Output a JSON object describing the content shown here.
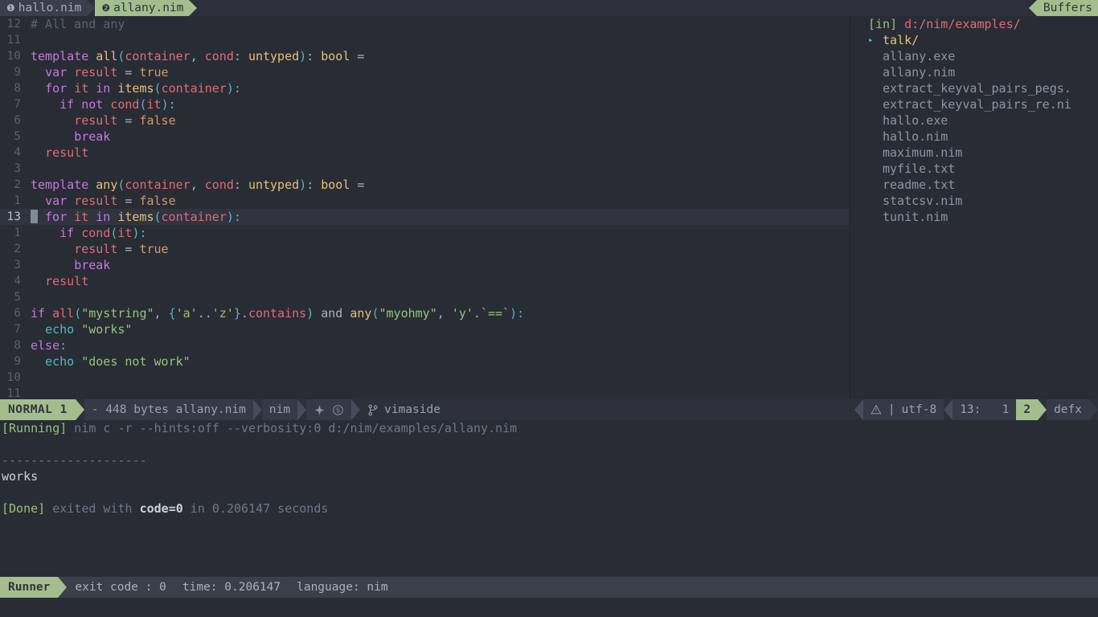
{
  "tabbar": {
    "tabs": [
      {
        "num": "❶",
        "label": "hallo.nim",
        "active": false
      },
      {
        "num": "❷",
        "label": "allany.nim",
        "active": true
      }
    ],
    "buffers_label": "Buffers"
  },
  "editor": {
    "lines": [
      {
        "gutter": "12",
        "current": false,
        "tokens": [
          {
            "t": "# All and any",
            "c": "t-cmt"
          }
        ]
      },
      {
        "gutter": "11",
        "current": false,
        "tokens": []
      },
      {
        "gutter": "10",
        "current": false,
        "tokens": [
          {
            "t": "template ",
            "c": "t-kw"
          },
          {
            "t": "all",
            "c": "t-fn"
          },
          {
            "t": "(",
            "c": "t-par"
          },
          {
            "t": "container",
            "c": "t-var"
          },
          {
            "t": ", ",
            "c": "t-plain"
          },
          {
            "t": "cond",
            "c": "t-var"
          },
          {
            "t": ": ",
            "c": "t-plain"
          },
          {
            "t": "untyped",
            "c": "t-typ"
          },
          {
            "t": ")",
            "c": "t-par"
          },
          {
            "t": ": ",
            "c": "t-plain"
          },
          {
            "t": "bool",
            "c": "t-typ"
          },
          {
            "t": " = ",
            "c": "t-plain"
          }
        ]
      },
      {
        "gutter": "9",
        "current": false,
        "tokens": [
          {
            "t": "  ",
            "c": "t-plain"
          },
          {
            "t": "var ",
            "c": "t-kw"
          },
          {
            "t": "result",
            "c": "t-var"
          },
          {
            "t": " = ",
            "c": "t-plain"
          },
          {
            "t": "true",
            "c": "t-bool"
          }
        ]
      },
      {
        "gutter": "8",
        "current": false,
        "tokens": [
          {
            "t": "  ",
            "c": "t-plain"
          },
          {
            "t": "for ",
            "c": "t-kw"
          },
          {
            "t": "it ",
            "c": "t-var"
          },
          {
            "t": "in ",
            "c": "t-kw"
          },
          {
            "t": "items",
            "c": "t-fn"
          },
          {
            "t": "(",
            "c": "t-par"
          },
          {
            "t": "container",
            "c": "t-var"
          },
          {
            "t": ")",
            "c": "t-par"
          },
          {
            "t": ":",
            "c": "t-par"
          }
        ]
      },
      {
        "gutter": "7",
        "current": false,
        "tokens": [
          {
            "t": "    ",
            "c": "t-plain"
          },
          {
            "t": "if ",
            "c": "t-kw"
          },
          {
            "t": "not ",
            "c": "t-kw"
          },
          {
            "t": "cond",
            "c": "t-var"
          },
          {
            "t": "(",
            "c": "t-par"
          },
          {
            "t": "it",
            "c": "t-var"
          },
          {
            "t": ")",
            "c": "t-par"
          },
          {
            "t": ":",
            "c": "t-par"
          }
        ]
      },
      {
        "gutter": "6",
        "current": false,
        "tokens": [
          {
            "t": "      ",
            "c": "t-plain"
          },
          {
            "t": "result",
            "c": "t-var"
          },
          {
            "t": " = ",
            "c": "t-plain"
          },
          {
            "t": "false",
            "c": "t-bool"
          }
        ]
      },
      {
        "gutter": "5",
        "current": false,
        "tokens": [
          {
            "t": "      ",
            "c": "t-plain"
          },
          {
            "t": "break",
            "c": "t-kw"
          }
        ]
      },
      {
        "gutter": "4",
        "current": false,
        "tokens": [
          {
            "t": "  ",
            "c": "t-plain"
          },
          {
            "t": "result",
            "c": "t-var"
          }
        ]
      },
      {
        "gutter": "3",
        "current": false,
        "tokens": []
      },
      {
        "gutter": "2",
        "current": false,
        "tokens": [
          {
            "t": "template ",
            "c": "t-kw"
          },
          {
            "t": "any",
            "c": "t-fn"
          },
          {
            "t": "(",
            "c": "t-par"
          },
          {
            "t": "container",
            "c": "t-var"
          },
          {
            "t": ", ",
            "c": "t-plain"
          },
          {
            "t": "cond",
            "c": "t-var"
          },
          {
            "t": ": ",
            "c": "t-plain"
          },
          {
            "t": "untyped",
            "c": "t-typ"
          },
          {
            "t": ")",
            "c": "t-par"
          },
          {
            "t": ": ",
            "c": "t-plain"
          },
          {
            "t": "bool",
            "c": "t-typ"
          },
          {
            "t": " = ",
            "c": "t-plain"
          }
        ]
      },
      {
        "gutter": "1",
        "current": false,
        "tokens": [
          {
            "t": "  ",
            "c": "t-plain"
          },
          {
            "t": "var ",
            "c": "t-kw"
          },
          {
            "t": "result",
            "c": "t-var"
          },
          {
            "t": " = ",
            "c": "t-plain"
          },
          {
            "t": "false",
            "c": "t-bool"
          }
        ]
      },
      {
        "gutter": "13",
        "current": true,
        "cursor": true,
        "tokens": [
          {
            "t": " ",
            "c": "t-plain"
          },
          {
            "t": "for ",
            "c": "t-kw"
          },
          {
            "t": "it ",
            "c": "t-var"
          },
          {
            "t": "in ",
            "c": "t-kw"
          },
          {
            "t": "items",
            "c": "t-fn"
          },
          {
            "t": "(",
            "c": "t-par"
          },
          {
            "t": "container",
            "c": "t-var"
          },
          {
            "t": ")",
            "c": "t-par"
          },
          {
            "t": ":",
            "c": "t-par"
          }
        ]
      },
      {
        "gutter": "1",
        "current": false,
        "tokens": [
          {
            "t": "    ",
            "c": "t-plain"
          },
          {
            "t": "if ",
            "c": "t-kw"
          },
          {
            "t": "cond",
            "c": "t-var"
          },
          {
            "t": "(",
            "c": "t-par"
          },
          {
            "t": "it",
            "c": "t-var"
          },
          {
            "t": ")",
            "c": "t-par"
          },
          {
            "t": ":",
            "c": "t-par"
          }
        ]
      },
      {
        "gutter": "2",
        "current": false,
        "tokens": [
          {
            "t": "      ",
            "c": "t-plain"
          },
          {
            "t": "result",
            "c": "t-var"
          },
          {
            "t": " = ",
            "c": "t-plain"
          },
          {
            "t": "true",
            "c": "t-bool"
          }
        ]
      },
      {
        "gutter": "3",
        "current": false,
        "tokens": [
          {
            "t": "      ",
            "c": "t-plain"
          },
          {
            "t": "break",
            "c": "t-kw"
          }
        ]
      },
      {
        "gutter": "4",
        "current": false,
        "tokens": [
          {
            "t": "  ",
            "c": "t-plain"
          },
          {
            "t": "result",
            "c": "t-var"
          }
        ]
      },
      {
        "gutter": "5",
        "current": false,
        "tokens": []
      },
      {
        "gutter": "6",
        "current": false,
        "tokens": [
          {
            "t": "if ",
            "c": "t-kw"
          },
          {
            "t": "all",
            "c": "t-var"
          },
          {
            "t": "(",
            "c": "t-par"
          },
          {
            "t": "\"mystring\"",
            "c": "t-str"
          },
          {
            "t": ", ",
            "c": "t-plain"
          },
          {
            "t": "{",
            "c": "t-par"
          },
          {
            "t": "'a'",
            "c": "t-str"
          },
          {
            "t": "..",
            "c": "t-plain"
          },
          {
            "t": "'z'",
            "c": "t-str"
          },
          {
            "t": "}",
            "c": "t-par"
          },
          {
            "t": ".",
            "c": "t-plain"
          },
          {
            "t": "contains",
            "c": "t-var"
          },
          {
            "t": ")",
            "c": "t-par"
          },
          {
            "t": " and ",
            "c": "t-plain"
          },
          {
            "t": "any",
            "c": "t-fn"
          },
          {
            "t": "(",
            "c": "t-par"
          },
          {
            "t": "\"myohmy\"",
            "c": "t-str"
          },
          {
            "t": ", ",
            "c": "t-plain"
          },
          {
            "t": "'y'",
            "c": "t-str"
          },
          {
            "t": ".",
            "c": "t-plain"
          },
          {
            "t": "`==`",
            "c": "t-str"
          },
          {
            "t": ")",
            "c": "t-par"
          },
          {
            "t": ":",
            "c": "t-par"
          }
        ]
      },
      {
        "gutter": "7",
        "current": false,
        "tokens": [
          {
            "t": "  ",
            "c": "t-plain"
          },
          {
            "t": "echo ",
            "c": "t-op"
          },
          {
            "t": "\"works\"",
            "c": "t-str"
          }
        ]
      },
      {
        "gutter": "8",
        "current": false,
        "tokens": [
          {
            "t": "else",
            "c": "t-kw"
          },
          {
            "t": ":",
            "c": "t-par"
          }
        ]
      },
      {
        "gutter": "9",
        "current": false,
        "tokens": [
          {
            "t": "  ",
            "c": "t-plain"
          },
          {
            "t": "echo ",
            "c": "t-op"
          },
          {
            "t": "\"does not work\"",
            "c": "t-str"
          }
        ]
      },
      {
        "gutter": "10",
        "current": false,
        "tokens": []
      },
      {
        "gutter": "11",
        "current": false,
        "tokens": []
      }
    ]
  },
  "explorer": {
    "header_prefix": "[in]",
    "header_path": "d:/nim/examples/",
    "items": [
      {
        "label": "talk/",
        "type": "dir",
        "expand_arrow": "▸"
      },
      {
        "label": "allany.exe",
        "type": "file"
      },
      {
        "label": "allany.nim",
        "type": "file"
      },
      {
        "label": "extract_keyval_pairs_pegs.",
        "type": "file"
      },
      {
        "label": "extract_keyval_pairs_re.ni",
        "type": "file"
      },
      {
        "label": "hallo.exe",
        "type": "file"
      },
      {
        "label": "hallo.nim",
        "type": "file"
      },
      {
        "label": "maximum.nim",
        "type": "file"
      },
      {
        "label": "myfile.txt",
        "type": "file"
      },
      {
        "label": "readme.txt",
        "type": "file"
      },
      {
        "label": "statcsv.nim",
        "type": "file"
      },
      {
        "label": "tunit.nim",
        "type": "file"
      }
    ]
  },
  "statusline": {
    "mode": "NORMAL",
    "mode_count": "1",
    "file_info": "- 448 bytes allany.nim",
    "filetype": "nim",
    "git_branch": "vimaside",
    "warn_count": "",
    "encoding": "utf-8",
    "position_line": "13:",
    "position_col": "1",
    "window_number": "2",
    "plugin": "defx",
    "sep_pipe": "|"
  },
  "terminal": {
    "lines": [
      {
        "parts": [
          {
            "t": "[Running]",
            "c": "t-green"
          },
          {
            "t": " nim c -r --hints:off --verbosity:0 d:/nim/examples/allany.nim",
            "c": "t-gray"
          }
        ]
      },
      {
        "parts": []
      },
      {
        "parts": [
          {
            "t": "--------------------",
            "c": "t-dash"
          }
        ]
      },
      {
        "parts": [
          {
            "t": "works",
            "c": "t-white"
          }
        ]
      },
      {
        "parts": []
      },
      {
        "parts": [
          {
            "t": "[Done]",
            "c": "t-green"
          },
          {
            "t": " exited with ",
            "c": "t-gray"
          },
          {
            "t": "code=0",
            "c": "t-bold"
          },
          {
            "t": " in 0.206147 seconds",
            "c": "t-gray"
          }
        ]
      }
    ]
  },
  "runner": {
    "label": "Runner",
    "exit_code": "exit code : 0",
    "time": "time: 0.206147",
    "language": "language: nim"
  },
  "colors": {
    "accent_green": "#a3be8c",
    "bg": "#282c34",
    "bg_status": "#2b303b",
    "bg_runner": "#3a4049"
  }
}
